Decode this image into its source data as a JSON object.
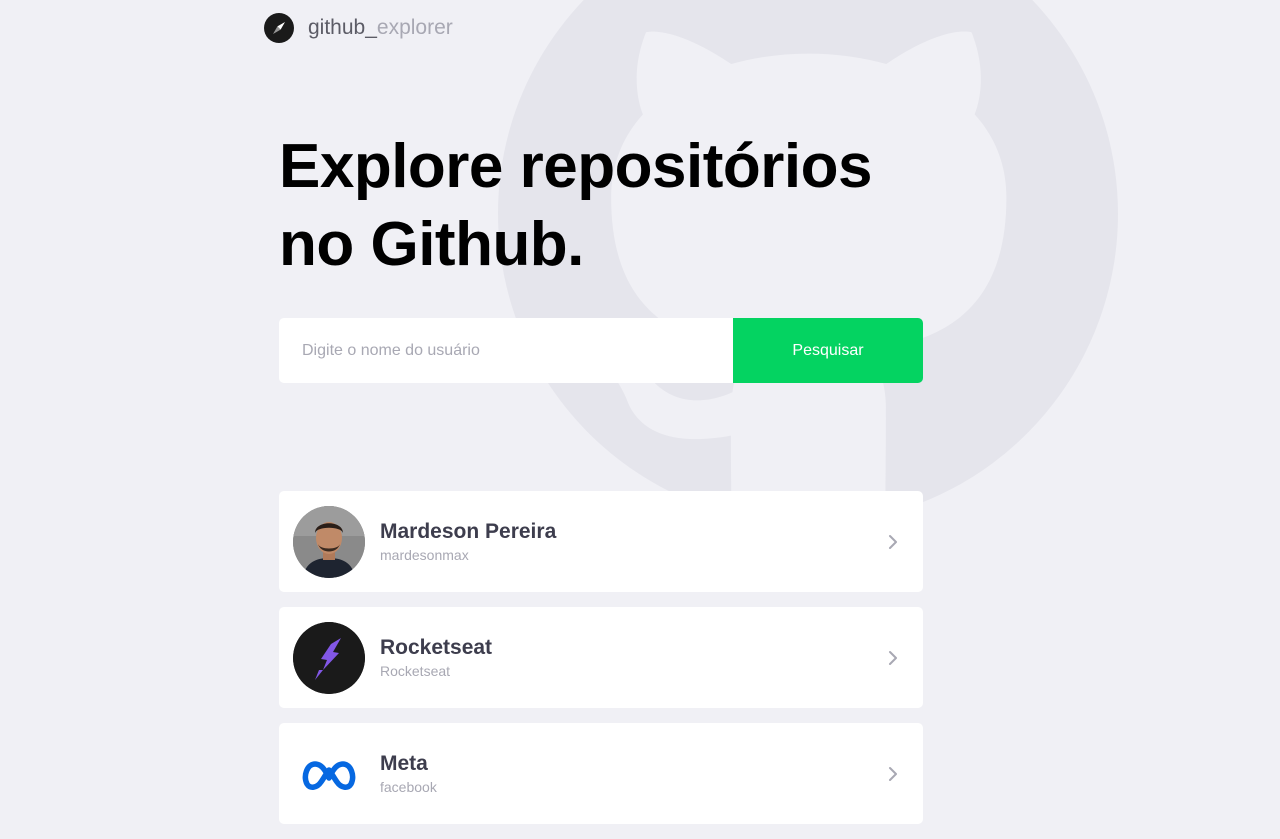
{
  "header": {
    "logo_main": "github_",
    "logo_secondary": "explorer",
    "logo_icon": "compass-icon"
  },
  "hero": {
    "title_line1": "Explore repositórios",
    "title_line2": "no Github."
  },
  "search": {
    "placeholder": "Digite o nome do usuário",
    "value": "",
    "button_label": "Pesquisar"
  },
  "users": [
    {
      "name": "Mardeson Pereira",
      "login": "mardesonmax",
      "avatar": "person-photo"
    },
    {
      "name": "Rocketseat",
      "login": "Rocketseat",
      "avatar": "rocket-logo"
    },
    {
      "name": "Meta",
      "login": "facebook",
      "avatar": "meta-logo"
    }
  ],
  "colors": {
    "background": "#F0F0F5",
    "accent": "#04D361",
    "title": "#000000",
    "text_primary": "#3D3D4D",
    "text_muted": "#A8A8B3",
    "card": "#FFFFFF",
    "meta_blue": "#0668E1",
    "rocketseat_purple": "#8257E6"
  }
}
